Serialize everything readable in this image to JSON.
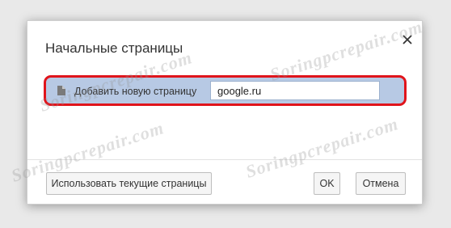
{
  "dialog": {
    "title": "Начальные страницы",
    "row": {
      "label": "Добавить новую страницу",
      "input_value": "google.ru"
    },
    "buttons": {
      "use_current": "Использовать текущие страницы",
      "ok": "OK",
      "cancel": "Отмена"
    }
  },
  "watermark": "Soringpcrepair.com",
  "colors": {
    "highlight_border": "#e0141b",
    "row_background": "#b7c9e4"
  },
  "icons": {
    "close": "close-icon",
    "page": "page-icon"
  }
}
